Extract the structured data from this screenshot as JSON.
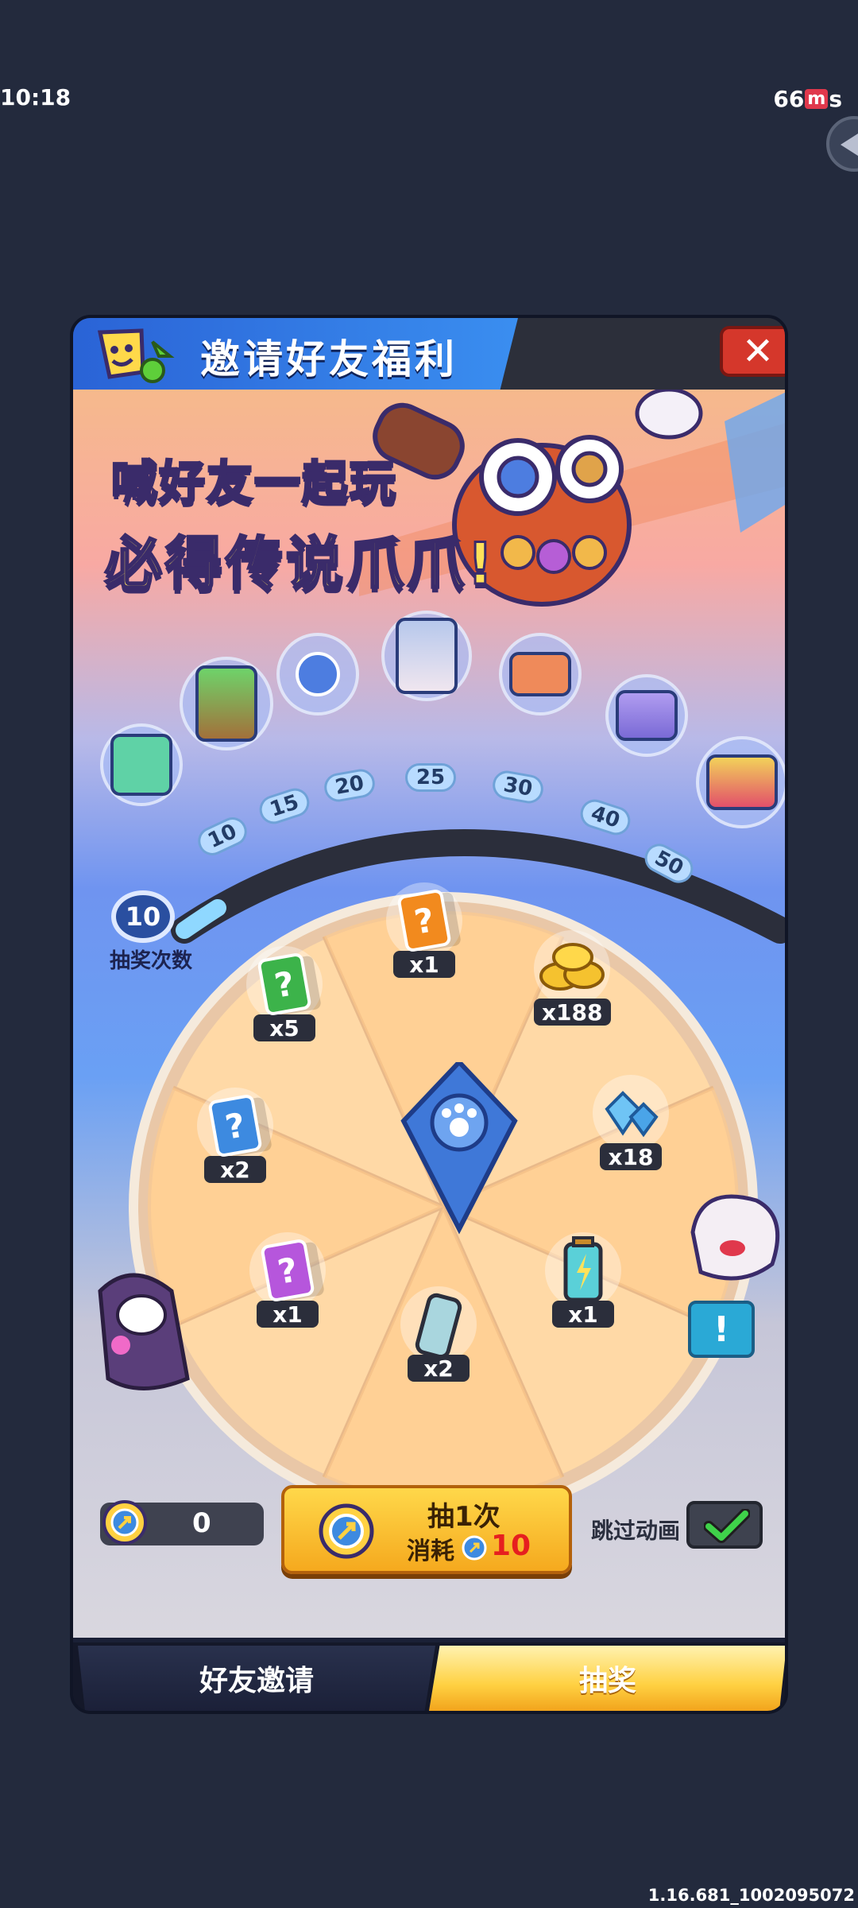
{
  "status_bar": {
    "time": "10:18",
    "ping_prefix": "66",
    "ping_mid": "m",
    "ping_suffix": "s"
  },
  "dialog": {
    "title": "邀请好友福利",
    "close_label": "✕",
    "promo_line1": "喊好友一起玩",
    "promo_line2": "必得传说爪爪!"
  },
  "progress": {
    "current_badge": "10",
    "label": "抽奖次数",
    "milestones": [
      "10",
      "15",
      "20",
      "25",
      "30",
      "40",
      "50"
    ]
  },
  "wheel": {
    "prizes": [
      {
        "name": "orange-cards",
        "qty": "x1"
      },
      {
        "name": "gold-coins",
        "qty": "x188"
      },
      {
        "name": "diamonds",
        "qty": "x18"
      },
      {
        "name": "battery",
        "qty": "x1"
      },
      {
        "name": "can",
        "qty": "x2"
      },
      {
        "name": "purple-cards",
        "qty": "x1"
      },
      {
        "name": "blue-cards",
        "qty": "x2"
      },
      {
        "name": "green-cards",
        "qty": "x5"
      }
    ]
  },
  "draw": {
    "ticket_count": "0",
    "button_main": "抽1次",
    "cost_label": "消耗",
    "cost_value": "10",
    "skip_label": "跳过动画",
    "skip_checked": true
  },
  "info_button": "!",
  "tabs": {
    "invite": "好友邀请",
    "draw": "抽奖"
  },
  "version": "1.16.681_1002095072",
  "colors": {
    "accent_yellow": "#ffd142",
    "header_blue": "#2a63d6",
    "close_red": "#d5372b"
  }
}
